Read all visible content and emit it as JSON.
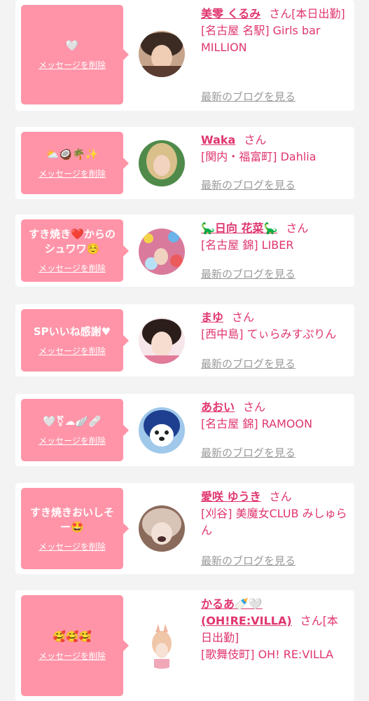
{
  "delete_label": "メッセージを削除",
  "blog_label": "最新のブログを見る",
  "san_label": "さん",
  "items": [
    {
      "message": "🤍",
      "name": "美零 くるみ",
      "suffix": "[本日出勤]",
      "shop": "[名古屋 名駅] Girls bar MILLION"
    },
    {
      "message": "⛅🥥🌴✨",
      "name": "Waka",
      "suffix": "",
      "shop": "[関内・福富町] Dahlia"
    },
    {
      "message": "すき焼き❤️からのシュワワ☺️",
      "name": "🦕日向 花菜🦕",
      "suffix": "",
      "shop": "[名古屋 錦] LIBER"
    },
    {
      "message": "SPいいね感謝♥",
      "name": "まゆ",
      "suffix": "",
      "shop": "[西中島] てぃらみすぷりん"
    },
    {
      "message": "🤍⚧☁🪽🩹",
      "name": "あおい",
      "suffix": "",
      "shop": "[名古屋 錦] RAMOON"
    },
    {
      "message": "すき焼きおいしそー🤩",
      "name": "愛咲 ゆうき",
      "suffix": "",
      "shop": "[刈谷] 美魔女CLUB みしゅらん"
    },
    {
      "message": "🥰🥰🥰",
      "name": "かるあ🍼🤍(OH!RE:VILLA)",
      "suffix": "[本日出勤]",
      "shop": "[歌舞伎町] OH! RE:VILLA"
    }
  ],
  "colors": {
    "accent": "#e0356e",
    "bubble": "#ff94a8",
    "background": "#f3f3f3",
    "muted": "#9a9a9a"
  }
}
